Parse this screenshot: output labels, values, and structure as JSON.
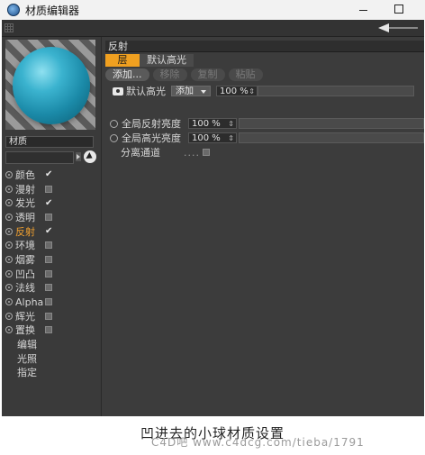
{
  "window": {
    "title": "材质编辑器"
  },
  "material": {
    "name": "材质",
    "channels": [
      {
        "label": "颜色",
        "checked": true,
        "active": false
      },
      {
        "label": "漫射",
        "checked": false,
        "active": false
      },
      {
        "label": "发光",
        "checked": true,
        "active": false
      },
      {
        "label": "透明",
        "checked": false,
        "active": false
      },
      {
        "label": "反射",
        "checked": true,
        "active": true
      },
      {
        "label": "环境",
        "checked": false,
        "active": false
      },
      {
        "label": "烟雾",
        "checked": false,
        "active": false
      },
      {
        "label": "凹凸",
        "checked": false,
        "active": false
      },
      {
        "label": "法线",
        "checked": false,
        "active": false
      },
      {
        "label": "Alpha",
        "checked": false,
        "active": false
      },
      {
        "label": "辉光",
        "checked": false,
        "active": false
      },
      {
        "label": "置换",
        "checked": false,
        "active": false
      }
    ],
    "extra_items": [
      "编辑",
      "光照",
      "指定"
    ]
  },
  "reflection": {
    "section_title": "反射",
    "tabs": [
      "层",
      "默认高光"
    ],
    "buttons": {
      "add": "添加...",
      "remove": "移除",
      "copy": "复制",
      "paste": "粘贴"
    },
    "highlight_row": {
      "label": "默认高光",
      "dropdown": "添加",
      "value": "100 %",
      "slider_level": 0
    },
    "global_reflection": {
      "label": "全局反射亮度",
      "value": "100 %",
      "slider_level": 0
    },
    "global_specular": {
      "label": "全局高光亮度",
      "value": "100 %",
      "slider_level": 0
    },
    "separate_pass": {
      "label": "分离通道",
      "dots": "....",
      "checked": false
    }
  },
  "caption": "凹进去的小球材质设置",
  "watermark": "C4D吧 www.c4dcg.com/tieba/1791"
}
